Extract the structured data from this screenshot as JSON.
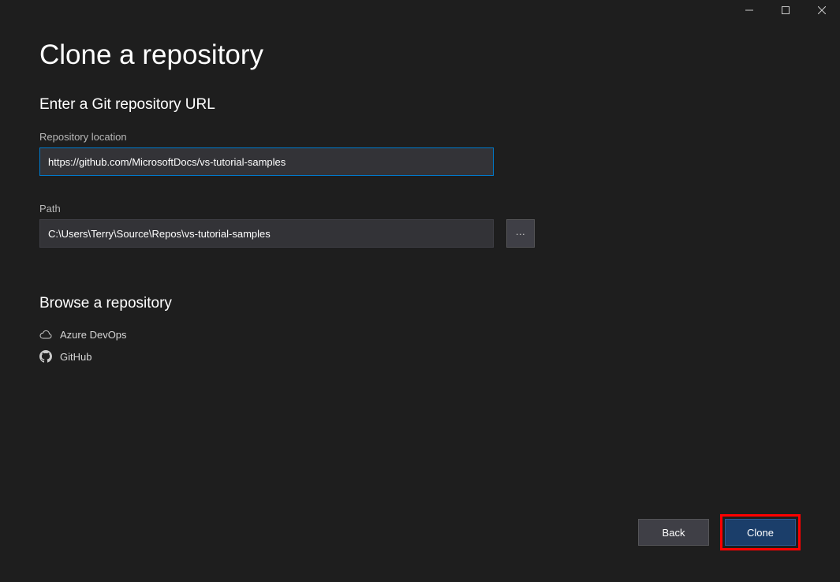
{
  "window": {
    "minimize": "−",
    "maximize": "☐",
    "close": "✕"
  },
  "page": {
    "title": "Clone a repository"
  },
  "section": {
    "heading": "Enter a Git repository URL"
  },
  "repo_location": {
    "label": "Repository location",
    "value": "https://github.com/MicrosoftDocs/vs-tutorial-samples"
  },
  "path": {
    "label": "Path",
    "value": "C:\\Users\\Terry\\Source\\Repos\\vs-tutorial-samples",
    "browse": "..."
  },
  "browse": {
    "heading": "Browse a repository",
    "providers": [
      {
        "label": "Azure DevOps"
      },
      {
        "label": "GitHub"
      }
    ]
  },
  "footer": {
    "back": "Back",
    "clone": "Clone"
  }
}
